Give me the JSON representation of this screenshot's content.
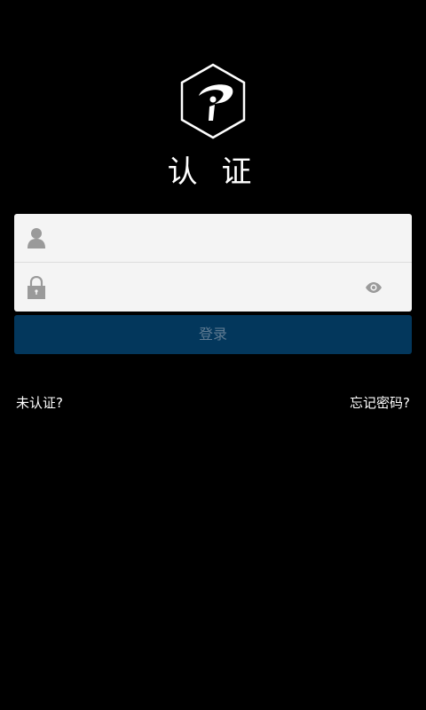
{
  "app": {
    "title": "认 证"
  },
  "form": {
    "username_placeholder": "",
    "password_placeholder": "",
    "login_label": "登录"
  },
  "links": {
    "not_verified": "未认证?",
    "forgot_password": "忘记密码?"
  },
  "icons": {
    "logo": "hexagon-logo-icon",
    "user": "user-icon",
    "lock": "lock-icon",
    "eye": "eye-icon"
  },
  "colors": {
    "background": "#000000",
    "button": "#03375c",
    "button_text": "#5f7b92",
    "input_bg": "#f4f4f4",
    "icon_gray": "#9a9a9a"
  }
}
